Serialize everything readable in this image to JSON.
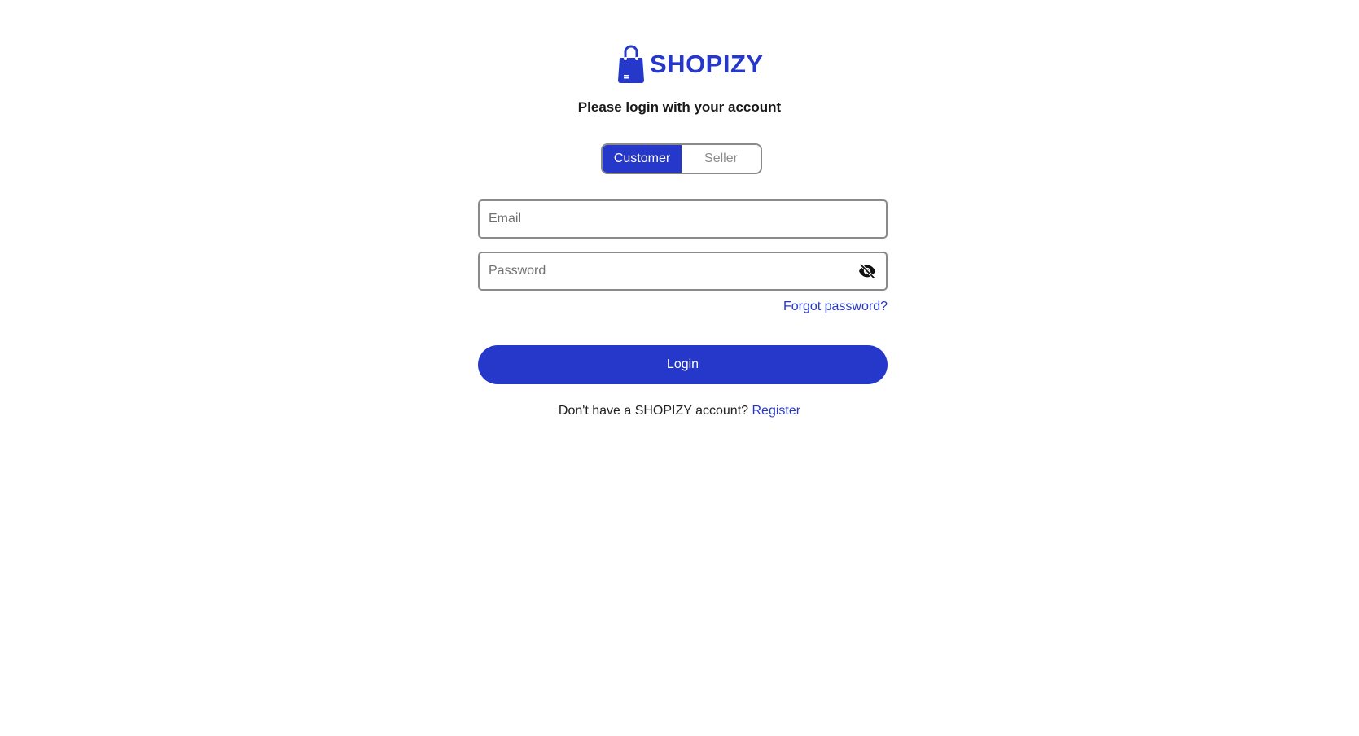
{
  "brand": {
    "name": "SHOPIZY",
    "logo_icon": "shopping-bag-icon",
    "color": "#2638c9"
  },
  "subtitle": "Please login with your account",
  "role_toggle": {
    "options": [
      "Customer",
      "Seller"
    ],
    "selected": "Customer"
  },
  "form": {
    "email_placeholder": "Email",
    "email_value": "",
    "password_placeholder": "Password",
    "password_value": "",
    "password_visibility_icon": "eye-slash-icon",
    "forgot_label": "Forgot password?",
    "login_label": "Login"
  },
  "register": {
    "prompt": "Don't have a SHOPIZY account?",
    "link_label": "Register"
  },
  "colors": {
    "accent": "#2638c9",
    "border": "#8a8a8a"
  }
}
